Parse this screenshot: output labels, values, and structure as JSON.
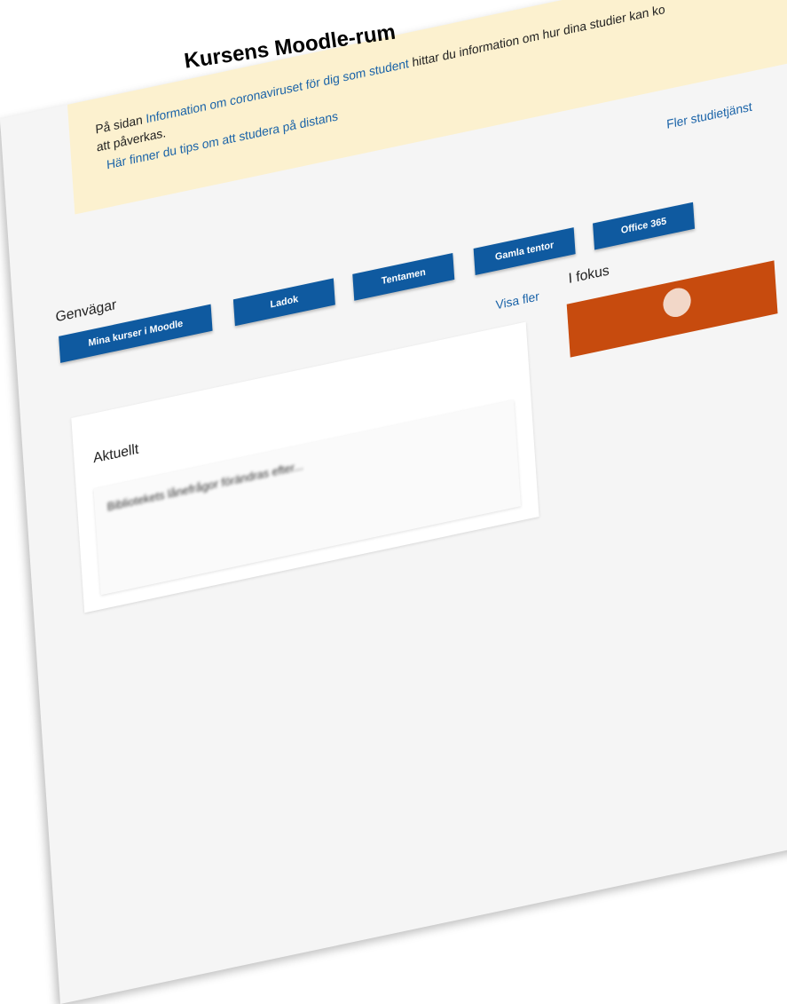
{
  "slide": {
    "title": "Kursens Moodle-rum"
  },
  "notice": {
    "line1_prefix": "På sidan ",
    "line1_link1": "Information om coronaviruset för dig som student",
    "line1_suffix": " hittar du information om hur dina studier kan ko",
    "line2": "att påverkas.",
    "line3_link": "Här finner du tips om att studera på distans"
  },
  "more_services_link": "Fler studietjänst",
  "shortcuts": {
    "title": "Genvägar",
    "buttons": [
      "Mina kurser i Moodle",
      "Ladok",
      "Tentamen",
      "Gamla tentor",
      "Office 365"
    ]
  },
  "news": {
    "show_more": "Visa fler",
    "title": "Aktuellt",
    "first_item_blurred": "Bibliotekets lånefrågor förändras efter..."
  },
  "focus": {
    "title": "I fokus"
  },
  "colors": {
    "accent_blue": "#0f5aa0",
    "link_blue": "#1a63a8",
    "notice_bg": "#fcf1cf",
    "focus_orange": "#c74b0e"
  }
}
